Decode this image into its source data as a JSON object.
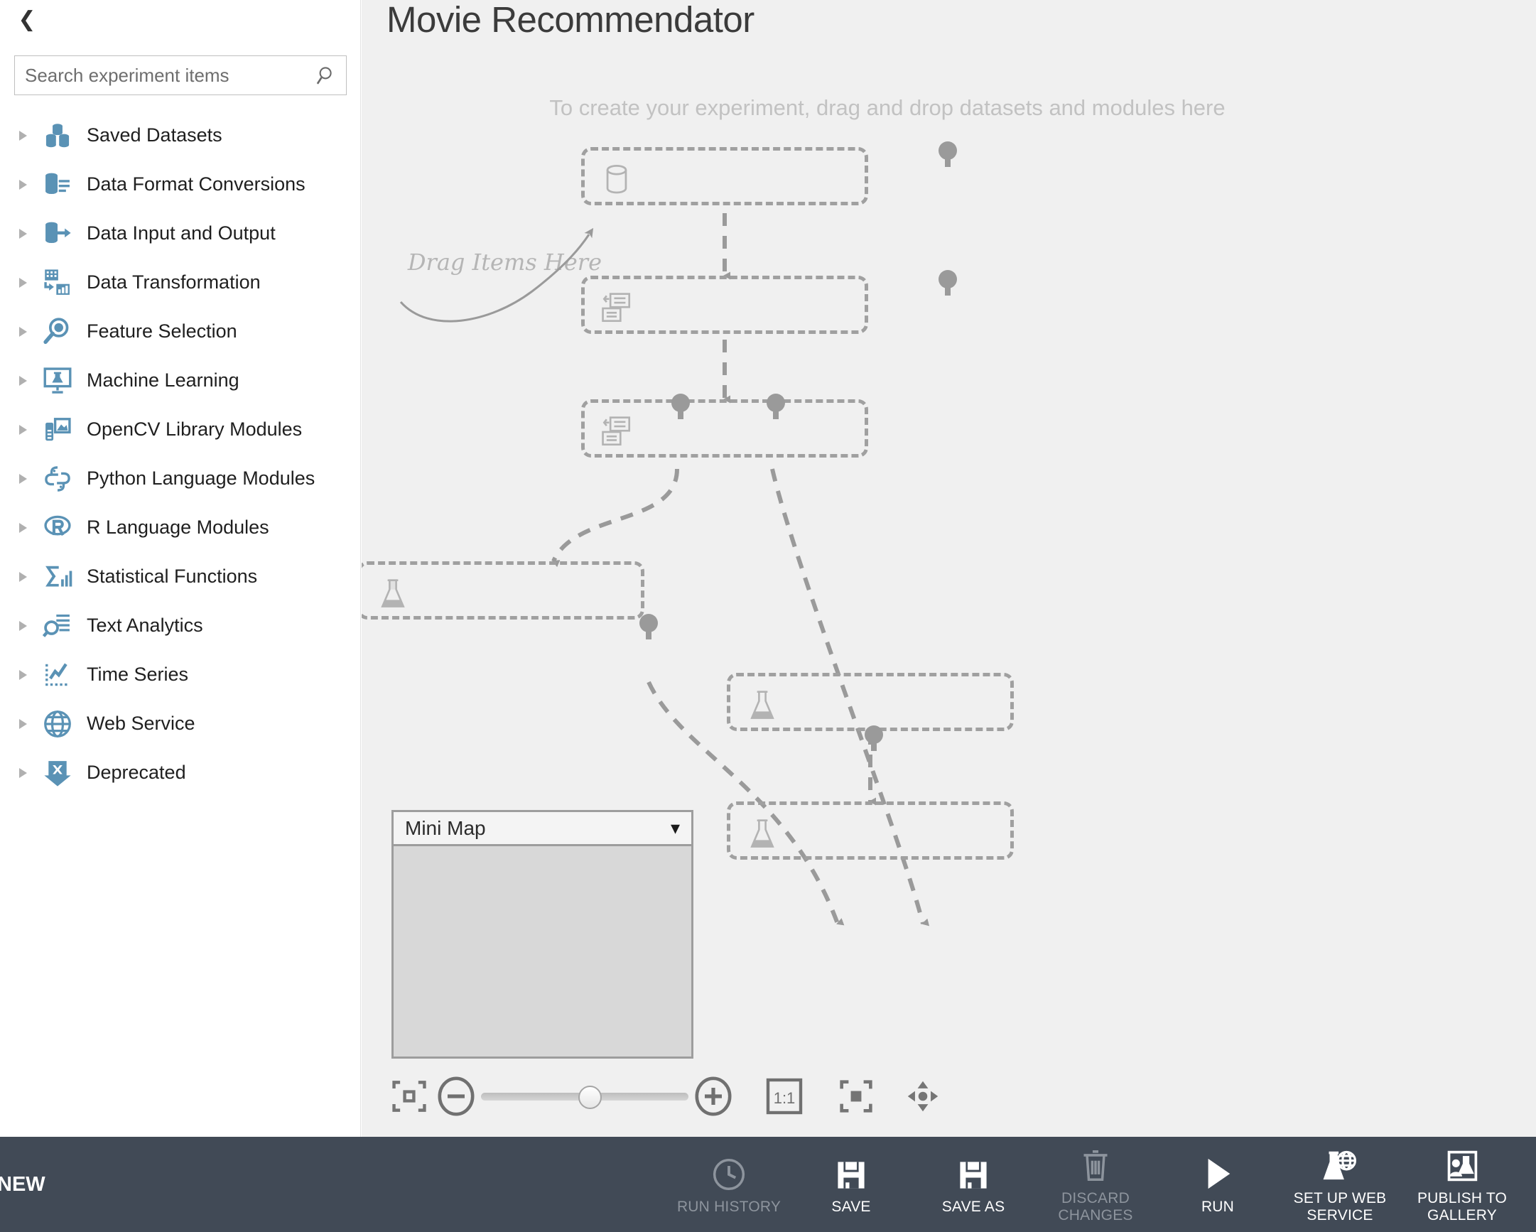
{
  "sidebar": {
    "collapse_icon": "chevron-left-icon",
    "search": {
      "placeholder": "Search experiment items",
      "value": "",
      "icon": "search-icon"
    },
    "items": [
      {
        "label": "Saved Datasets",
        "icon": "saved-datasets-icon"
      },
      {
        "label": "Data Format Conversions",
        "icon": "data-format-conversions-icon"
      },
      {
        "label": "Data Input and Output",
        "icon": "data-input-output-icon"
      },
      {
        "label": "Data Transformation",
        "icon": "data-transformation-icon"
      },
      {
        "label": "Feature Selection",
        "icon": "feature-selection-icon"
      },
      {
        "label": "Machine Learning",
        "icon": "machine-learning-icon"
      },
      {
        "label": "OpenCV Library Modules",
        "icon": "opencv-library-icon"
      },
      {
        "label": "Python Language Modules",
        "icon": "python-language-icon"
      },
      {
        "label": "R Language Modules",
        "icon": "r-language-icon"
      },
      {
        "label": "Statistical Functions",
        "icon": "statistical-functions-icon"
      },
      {
        "label": "Text Analytics",
        "icon": "text-analytics-icon"
      },
      {
        "label": "Time Series",
        "icon": "time-series-icon"
      },
      {
        "label": "Web Service",
        "icon": "web-service-icon"
      },
      {
        "label": "Deprecated",
        "icon": "deprecated-icon"
      }
    ]
  },
  "canvas": {
    "title": "Movie Recommendator",
    "hint": "To create your experiment, drag and drop datasets and modules here",
    "drag_hint": "Drag Items Here",
    "nodes": [
      {
        "icon": "dataset-cylinder-icon"
      },
      {
        "icon": "transform-list-icon"
      },
      {
        "icon": "transform-list-icon"
      },
      {
        "icon": "flask-icon"
      },
      {
        "icon": "flask-icon"
      },
      {
        "icon": "flask-icon"
      }
    ]
  },
  "minimap": {
    "title": "Mini Map",
    "chevron_icon": "chevron-down-icon"
  },
  "zoom_toolbar": {
    "fit_to_screen": "fit-to-screen-icon",
    "zoom_out": "minus-circle-icon",
    "zoom_in": "plus-circle-icon",
    "slider_value": 47,
    "actual_size_label": "1:1",
    "fit_selection": "fit-selection-icon",
    "pan": "pan-navigate-icon"
  },
  "bottom_bar": {
    "new_label": "NEW",
    "actions": [
      {
        "label": "RUN HISTORY",
        "icon": "clock-icon",
        "disabled": true
      },
      {
        "label": "SAVE",
        "icon": "save-icon",
        "disabled": false
      },
      {
        "label": "SAVE AS",
        "icon": "save-icon",
        "disabled": false
      },
      {
        "label": "DISCARD CHANGES",
        "icon": "trash-icon",
        "disabled": true
      },
      {
        "label": "RUN",
        "icon": "play-icon",
        "disabled": false
      },
      {
        "label": "SET UP WEB\nSERVICE",
        "icon": "web-service-flask-icon",
        "disabled": false
      },
      {
        "label": "PUBLISH TO\nGALLERY",
        "icon": "publish-gallery-icon",
        "disabled": false
      }
    ]
  },
  "colors": {
    "sidebar_icon": "#5a92b5",
    "canvas_bg": "#f0f0f0",
    "bottom_bar": "#414a56",
    "node_dash": "#a0a0a0",
    "hint_text": "#c2c2c2"
  }
}
